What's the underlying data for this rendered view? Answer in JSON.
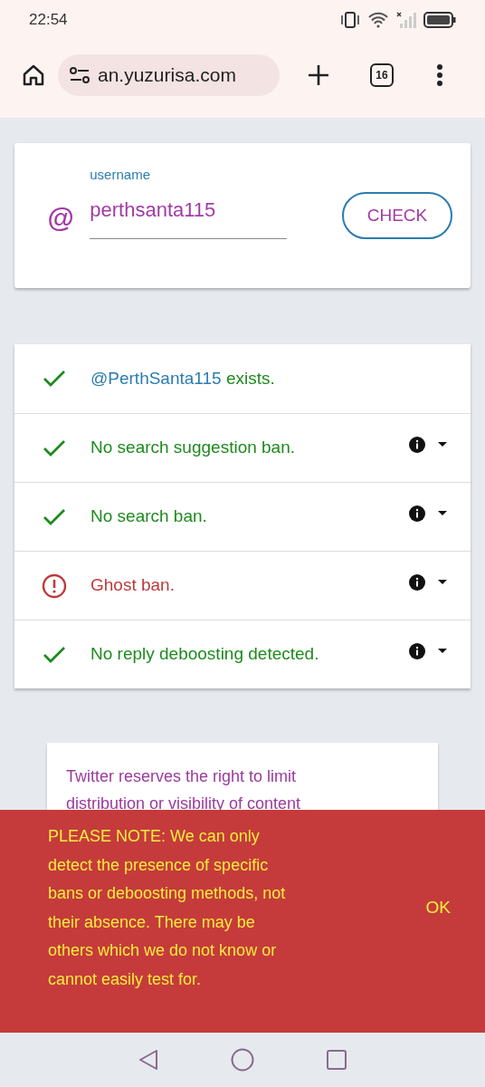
{
  "status_bar": {
    "time": "22:54"
  },
  "browser": {
    "url": "an.yuzurisa.com",
    "tab_count": "16"
  },
  "form": {
    "label": "username",
    "prefix": "@",
    "value": "perthsanta115",
    "button": "CHECK"
  },
  "results": [
    {
      "kind": "ok",
      "handle": "@PerthSanta115",
      "text": " exists."
    },
    {
      "kind": "ok",
      "text": "No search suggestion ban.",
      "expanded": false
    },
    {
      "kind": "ok",
      "text": "No search ban.",
      "expanded": false
    },
    {
      "kind": "warn",
      "text": "Ghost ban.",
      "expanded": false
    },
    {
      "kind": "ok",
      "text": "No reply deboosting detected.",
      "expanded": false
    }
  ],
  "info_card": {
    "lines": [
      "Twitter reserves the right to limit",
      "distribution or visibility of content"
    ]
  },
  "notice": {
    "text": "PLEASE NOTE: We can only detect the presence of specific bans or deboosting methods, not their absence. There may be others which we do not know or cannot easily test for.",
    "button": "OK"
  }
}
